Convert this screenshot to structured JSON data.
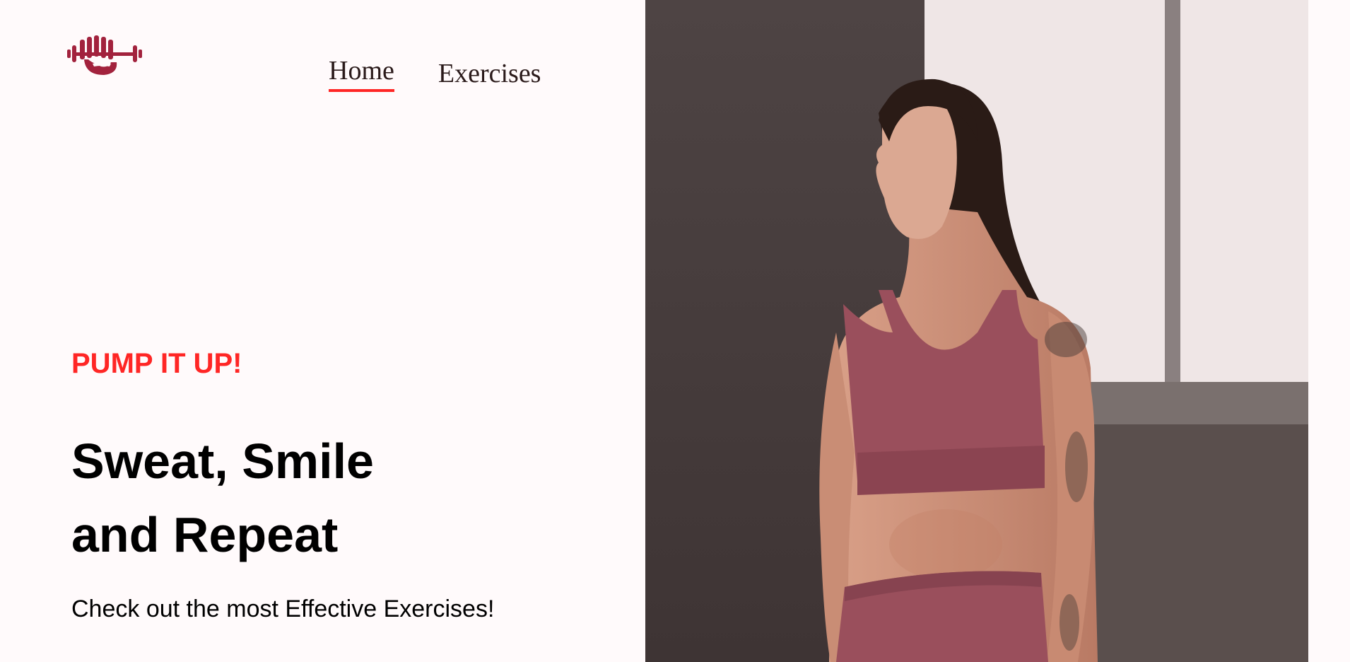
{
  "logo": {
    "icon": "dumbbell-fist-icon",
    "color": "#A2223D"
  },
  "nav": {
    "items": [
      {
        "label": "Home",
        "active": true
      },
      {
        "label": "Exercises",
        "active": false
      }
    ],
    "active_underline_color": "#FF2625"
  },
  "hero": {
    "tagline": "PUMP IT UP!",
    "headline_line1": "Sweat, Smile",
    "headline_line2": "and Repeat",
    "subtext": "Check out the most Effective Exercises!",
    "accent_color": "#FF2625"
  },
  "banner_image": {
    "subject": "woman in mauve sports bra and leggings by a window"
  }
}
